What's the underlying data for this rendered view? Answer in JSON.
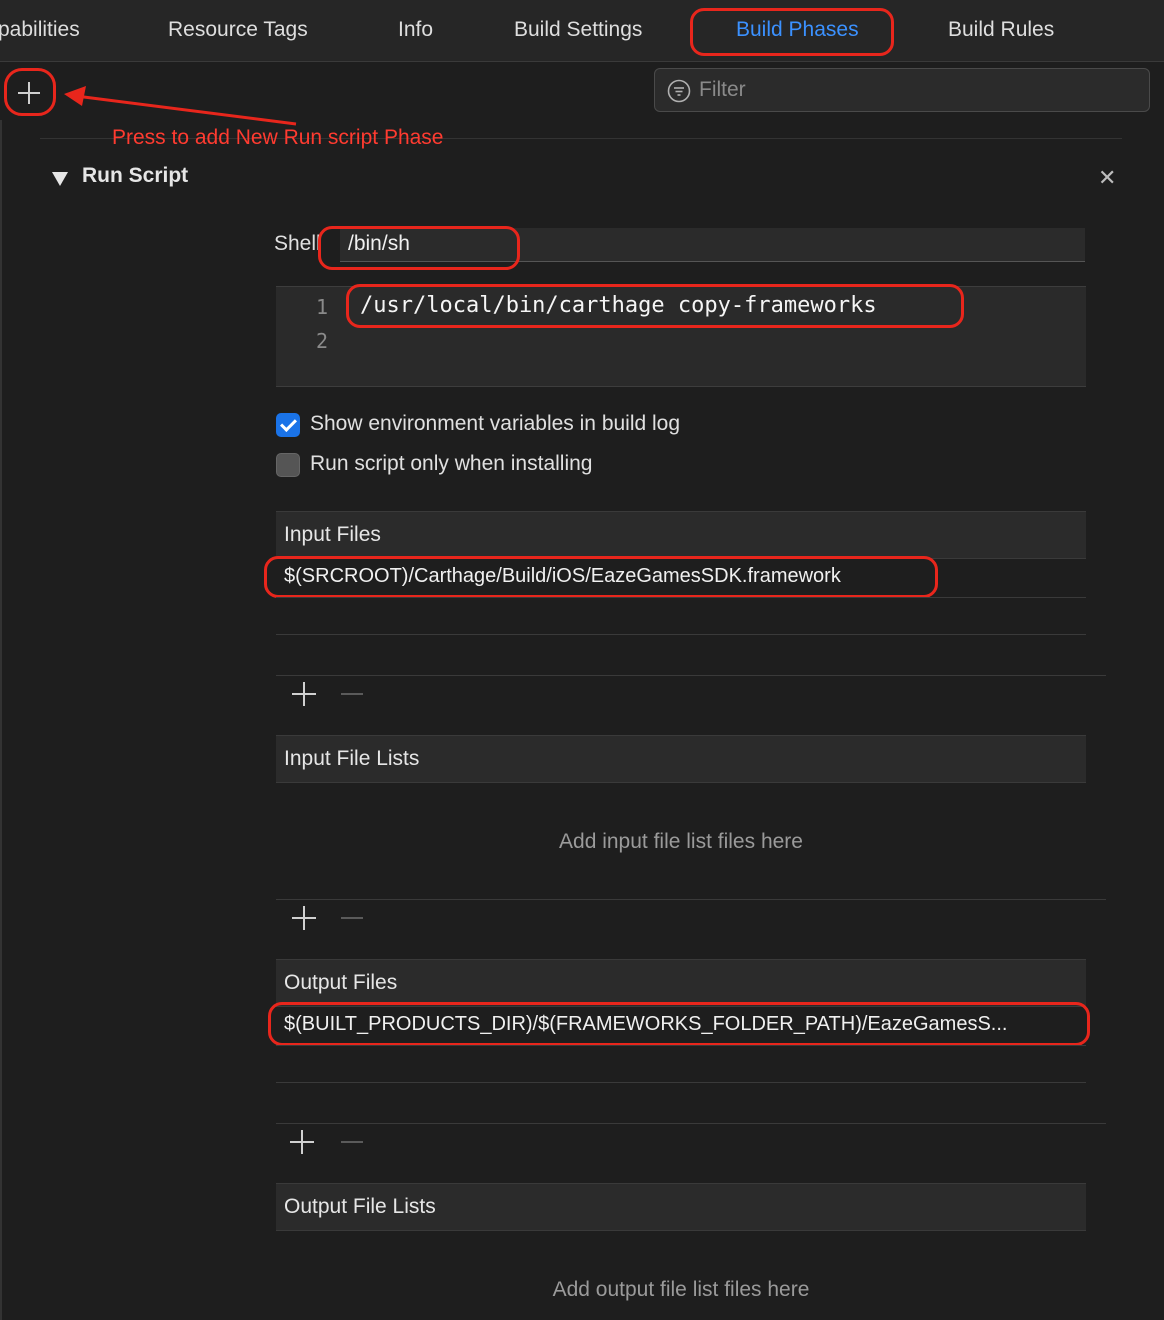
{
  "tabs": [
    {
      "label": "pabilities",
      "active": false
    },
    {
      "label": "Resource Tags",
      "active": false
    },
    {
      "label": "Info",
      "active": false
    },
    {
      "label": "Build Settings",
      "active": false
    },
    {
      "label": "Build Phases",
      "active": true
    },
    {
      "label": "Build Rules",
      "active": false
    }
  ],
  "filter": {
    "placeholder": "Filter"
  },
  "annotation": "Press to add New Run script Phase",
  "phase": {
    "title": "Run Script",
    "shell_label": "Shell",
    "shell_value": "/bin/sh",
    "line_numbers": [
      "1",
      "2"
    ],
    "script_line": "/usr/local/bin/carthage copy-frameworks",
    "options": [
      {
        "label": "Show environment variables in build log",
        "checked": true
      },
      {
        "label": "Run script only when installing",
        "checked": false
      }
    ],
    "input_files": {
      "header": "Input Files",
      "items": [
        "$(SRCROOT)/Carthage/Build/iOS/EazeGamesSDK.framework"
      ]
    },
    "input_file_lists": {
      "header": "Input File Lists",
      "empty": "Add input file list files here"
    },
    "output_files": {
      "header": "Output Files",
      "items": [
        "$(BUILT_PRODUCTS_DIR)/$(FRAMEWORKS_FOLDER_PATH)/EazeGamesS..."
      ]
    },
    "output_file_lists": {
      "header": "Output File Lists",
      "empty": "Add output file list files here"
    }
  },
  "colors": {
    "accent": "#3b91ff",
    "annotation": "#ff3b30",
    "background": "#1e1e1e"
  },
  "icons": [
    "plus-icon",
    "filter-icon",
    "disclosure-triangle-icon",
    "close-icon",
    "checkbox-icon",
    "minus-icon"
  ]
}
